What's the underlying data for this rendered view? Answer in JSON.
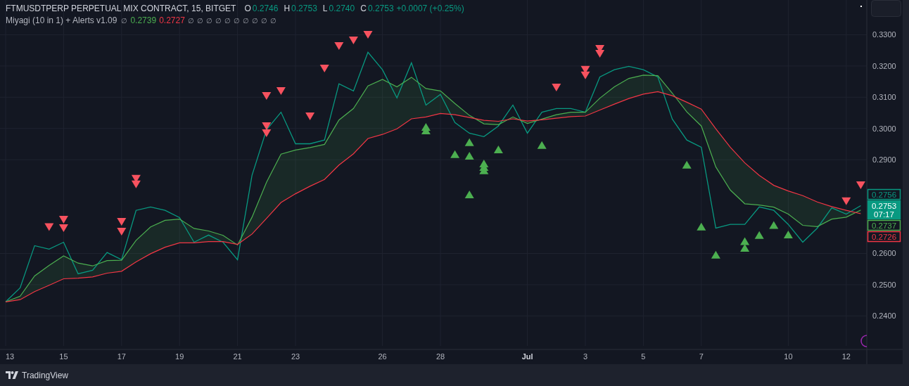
{
  "legend": {
    "symbol": "FTMUSDTPERP PERPETUAL MIX CONTRACT, 15, BITGET",
    "ohlc": [
      {
        "label": "O",
        "value": "0.2746"
      },
      {
        "label": "H",
        "value": "0.2753"
      },
      {
        "label": "L",
        "value": "0.2740"
      },
      {
        "label": "C",
        "value": "0.2753"
      }
    ],
    "change": "+0.0007 (+0.25%)",
    "indicator": "Miyagi (10 in 1) + Alerts v1.09",
    "indicator_values": [
      {
        "text": "∅",
        "kind": "na"
      },
      {
        "text": "0.2739",
        "kind": "fast"
      },
      {
        "text": "0.2727",
        "kind": "slow"
      },
      {
        "text": "∅",
        "kind": "na"
      },
      {
        "text": "∅",
        "kind": "na"
      },
      {
        "text": "∅",
        "kind": "na"
      },
      {
        "text": "∅",
        "kind": "na"
      },
      {
        "text": "∅",
        "kind": "na"
      },
      {
        "text": "∅",
        "kind": "na"
      },
      {
        "text": "∅",
        "kind": "na"
      },
      {
        "text": "∅",
        "kind": "na"
      },
      {
        "text": "∅",
        "kind": "na"
      },
      {
        "text": "∅",
        "kind": "na"
      }
    ]
  },
  "chart": {
    "chart_data": {
      "type": "line",
      "grid": true,
      "categories": [
        "13",
        null,
        null,
        null,
        "15",
        null,
        null,
        null,
        "17",
        null,
        null,
        null,
        "19",
        null,
        null,
        null,
        "21",
        null,
        null,
        null,
        "23",
        null,
        null,
        null,
        null,
        null,
        "26",
        null,
        null,
        null,
        "28",
        null,
        null,
        null,
        null,
        null,
        "Jul",
        null,
        null,
        null,
        "3",
        null,
        null,
        null,
        "5",
        null,
        null,
        null,
        "7",
        null,
        null,
        null,
        null,
        null,
        "10",
        null,
        null,
        null,
        "12",
        null
      ],
      "series": [
        {
          "color": "#089981",
          "values": [
            0.2445,
            0.249,
            0.2625,
            0.2614,
            0.2636,
            0.2535,
            0.2546,
            0.2603,
            0.258,
            0.2738,
            0.2749,
            0.2738,
            0.2715,
            0.2636,
            0.2659,
            0.2636,
            0.258,
            0.285,
            0.2996,
            0.3052,
            0.2951,
            0.2951,
            0.2963,
            0.3143,
            0.312,
            0.3244,
            0.3188,
            0.3098,
            0.321,
            0.3075,
            0.3109,
            0.3019,
            0.2985,
            0.2974,
            0.3008,
            0.3075,
            0.2985,
            0.3052,
            0.3064,
            0.3064,
            0.3052,
            0.3165,
            0.3188,
            0.3199,
            0.3188,
            0.3165,
            0.303,
            0.2963,
            0.294,
            0.2681,
            0.2693,
            0.2693,
            0.2749,
            0.2738,
            0.2693,
            0.2636,
            0.2681,
            0.2746,
            0.2726,
            0.2753
          ]
        },
        {
          "color": "#4caf50",
          "values": [
            0.2445,
            0.2463,
            0.2528,
            0.2562,
            0.2592,
            0.2569,
            0.256,
            0.2577,
            0.2578,
            0.2642,
            0.2685,
            0.2706,
            0.271,
            0.268,
            0.2672,
            0.2658,
            0.2627,
            0.2716,
            0.2828,
            0.2918,
            0.2931,
            0.2939,
            0.2949,
            0.3027,
            0.3064,
            0.3136,
            0.3157,
            0.3133,
            0.3164,
            0.3128,
            0.312,
            0.308,
            0.3042,
            0.3015,
            0.3012,
            0.3037,
            0.3016,
            0.303,
            0.3044,
            0.3052,
            0.3052,
            0.3097,
            0.3133,
            0.316,
            0.3171,
            0.3169,
            0.3113,
            0.3053,
            0.3008,
            0.2877,
            0.2803,
            0.2759,
            0.2755,
            0.2748,
            0.2726,
            0.269,
            0.2686,
            0.271,
            0.2716,
            0.2739
          ]
        },
        {
          "color": "#f23645",
          "values": [
            0.2445,
            0.2452,
            0.2478,
            0.2498,
            0.2519,
            0.2521,
            0.2525,
            0.2537,
            0.2543,
            0.2573,
            0.2599,
            0.262,
            0.2634,
            0.2634,
            0.2638,
            0.2638,
            0.2629,
            0.2662,
            0.2712,
            0.2763,
            0.2791,
            0.2815,
            0.2837,
            0.2883,
            0.2919,
            0.2968,
            0.2981,
            0.2999,
            0.3031,
            0.3037,
            0.3048,
            0.3044,
            0.3035,
            0.3026,
            0.3023,
            0.3031,
            0.3024,
            0.3028,
            0.3033,
            0.3038,
            0.304,
            0.3059,
            0.3078,
            0.3096,
            0.311,
            0.3118,
            0.3105,
            0.3084,
            0.3062,
            0.2999,
            0.294,
            0.289,
            0.285,
            0.2818,
            0.28,
            0.2785,
            0.2765,
            0.275,
            0.2738,
            0.2727
          ]
        },
        {
          "color": "#f7525f",
          "values": [
            null,
            null,
            null,
            0.2684,
            0.2708,
            null,
            null,
            null,
            0.2701,
            0.2839,
            null,
            null,
            null,
            null,
            null,
            null,
            null,
            null,
            0.3104,
            0.312,
            null,
            0.3039,
            0.3192,
            0.3264,
            0.3282,
            0.33,
            null,
            null,
            null,
            null,
            null,
            null,
            null,
            null,
            null,
            null,
            null,
            null,
            0.3131,
            null,
            0.3188,
            0.3255,
            null,
            null,
            null,
            null,
            null,
            null,
            null,
            null,
            null,
            null,
            null,
            null,
            null,
            null,
            null,
            null,
            0.2767,
            0.2818
          ],
          "type": "scatter"
        },
        {
          "type": "scatter",
          "color": "#f7525f",
          "values": [
            null,
            null,
            null,
            null,
            0.2681,
            null,
            null,
            null,
            0.267,
            0.2821,
            null,
            null,
            null,
            null,
            null,
            null,
            null,
            null,
            0.3007,
            null,
            null,
            null,
            null,
            null,
            null,
            null,
            null,
            null,
            null,
            null,
            null,
            null,
            null,
            null,
            null,
            null,
            null,
            null,
            null,
            null,
            0.317,
            0.3239,
            null,
            null,
            null,
            null,
            null,
            null,
            null,
            null,
            null,
            null,
            null,
            null,
            null,
            null,
            null,
            null,
            null,
            null
          ]
        },
        {
          "type": "scatter",
          "color": "#f7525f",
          "values": [
            null,
            null,
            null,
            null,
            null,
            null,
            null,
            null,
            null,
            null,
            null,
            null,
            null,
            null,
            null,
            null,
            null,
            null,
            0.2985,
            null,
            null,
            null,
            null,
            null,
            null,
            null,
            null,
            null,
            null,
            null,
            null,
            null,
            null,
            null,
            null,
            null,
            null,
            null,
            null,
            null,
            null,
            null,
            null,
            null,
            null,
            null,
            null,
            null,
            null,
            null,
            null,
            null,
            null,
            null,
            null,
            null,
            null,
            null,
            null,
            null
          ]
        },
        {
          "color": "#4caf50",
          "values": [
            null,
            null,
            null,
            null,
            null,
            null,
            null,
            null,
            null,
            null,
            null,
            null,
            null,
            null,
            null,
            null,
            null,
            null,
            null,
            null,
            null,
            null,
            null,
            null,
            null,
            null,
            null,
            null,
            null,
            0.3005,
            null,
            0.2918,
            0.2956,
            0.2888,
            0.2933,
            null,
            null,
            0.2947,
            null,
            null,
            null,
            null,
            null,
            null,
            null,
            null,
            null,
            0.2884,
            0.2686,
            0.2596,
            null,
            0.2639,
            0.2659,
            0.2691,
            0.2661,
            null,
            null,
            null,
            null,
            null
          ],
          "type": "scatter"
        },
        {
          "color": "#4caf50",
          "values": [
            null,
            null,
            null,
            null,
            null,
            null,
            null,
            null,
            null,
            null,
            null,
            null,
            null,
            null,
            null,
            null,
            null,
            null,
            null,
            null,
            null,
            null,
            null,
            null,
            null,
            null,
            null,
            null,
            null,
            0.2994,
            null,
            null,
            0.2913,
            0.2877,
            null,
            null,
            null,
            null,
            null,
            null,
            null,
            null,
            null,
            null,
            null,
            null,
            null,
            null,
            null,
            null,
            null,
            0.2618,
            null,
            null,
            null,
            null,
            null,
            null,
            null,
            null
          ],
          "type": "scatter"
        },
        {
          "color": "#4caf50",
          "values": [
            null,
            null,
            null,
            null,
            null,
            null,
            null,
            null,
            null,
            null,
            null,
            null,
            null,
            null,
            null,
            null,
            null,
            null,
            null,
            null,
            null,
            null,
            null,
            null,
            null,
            null,
            null,
            null,
            null,
            null,
            null,
            null,
            0.2789,
            0.2866,
            null,
            null,
            null,
            null,
            null,
            null,
            null,
            null,
            null,
            null,
            null,
            null,
            null,
            null,
            null,
            null,
            null,
            null,
            null,
            null,
            null,
            null,
            null,
            null,
            null,
            null
          ],
          "type": "scatter"
        }
      ],
      "ylim": [
        0.2304,
        0.341125
      ],
      "yticks": [
        {
          "value": 0.24,
          "label": "0.2400"
        },
        {
          "value": 0.25,
          "label": "0.2500"
        },
        {
          "value": 0.26,
          "label": "0.2600"
        },
        {
          "value": 0.29,
          "label": "0.2900"
        },
        {
          "value": 0.3,
          "label": "0.3000"
        },
        {
          "value": 0.31,
          "label": "0.3100"
        },
        {
          "value": 0.32,
          "label": "0.3200"
        },
        {
          "value": 0.33,
          "label": "0.3300"
        }
      ]
    },
    "price_tags": [
      {
        "kind": "outline",
        "color": "#089981",
        "lines": [
          "0.2756"
        ]
      },
      {
        "kind": "filled",
        "color": "#089981",
        "lines": [
          "0.2753",
          "07:17"
        ]
      },
      {
        "kind": "outline",
        "color": "#4caf50",
        "lines": [
          "0.2737"
        ]
      },
      {
        "kind": "outline",
        "color": "#f23645",
        "lines": [
          "0.2726"
        ]
      }
    ]
  },
  "footer": {
    "brand": "TradingView"
  }
}
